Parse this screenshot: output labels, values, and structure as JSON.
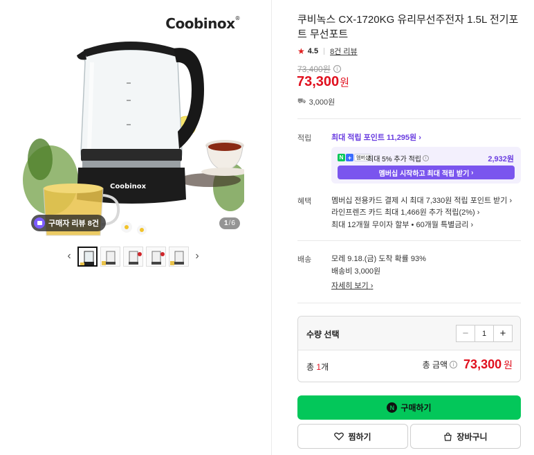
{
  "gallery": {
    "brand_logo": "Coobinox",
    "review_badge": "구매자 리뷰 8건",
    "page_current": "1",
    "page_total": "6",
    "prev_icon": "chevron-left-icon",
    "next_icon": "chevron-right-icon"
  },
  "product": {
    "title": "쿠비녹스 CX-1720KG 유리무선주전자 1.5L 전기포트 무선포트",
    "rating": "4.5",
    "review_link": "8건 리뷰",
    "original_price": "73,400원",
    "price": "73,300",
    "price_unit": "원",
    "shipping_fee": "3,000원"
  },
  "points": {
    "label": "적립",
    "max_link": "최대 적립 포인트 11,295원",
    "np_text": "최대 5% 추가 적립",
    "np_amount": "2,932원",
    "np_button": "멤버십 시작하고 최대 적립 받기",
    "np_badge": "멤버십"
  },
  "benefits": {
    "label": "혜택",
    "items": [
      "멤버십 전용카드 결제 시 최대 7,330원 적립 포인트 받기",
      "라인프렌즈 카드 최대 1,466원 추가 적립(2%)",
      "최대 12개월 무이자 할부 • 60개월 특별금리"
    ]
  },
  "delivery": {
    "label": "배송",
    "arrival": "모레 9.18.(금) 도착 확률 93%",
    "fee": "배송비 3,000원",
    "detail_link": "자세히 보기"
  },
  "order": {
    "qty_label": "수량 선택",
    "qty_value": "1",
    "total_count_prefix": "총 ",
    "total_count_num": "1",
    "total_count_suffix": "개",
    "total_label": "총 금액",
    "total_value": "73,300",
    "total_unit": "원"
  },
  "actions": {
    "buy": "구매하기",
    "wish": "찜하기",
    "cart": "장바구니"
  },
  "colors": {
    "accent_red": "#e0101e",
    "naver_green": "#03c75a",
    "points_purple": "#6a3de0"
  }
}
